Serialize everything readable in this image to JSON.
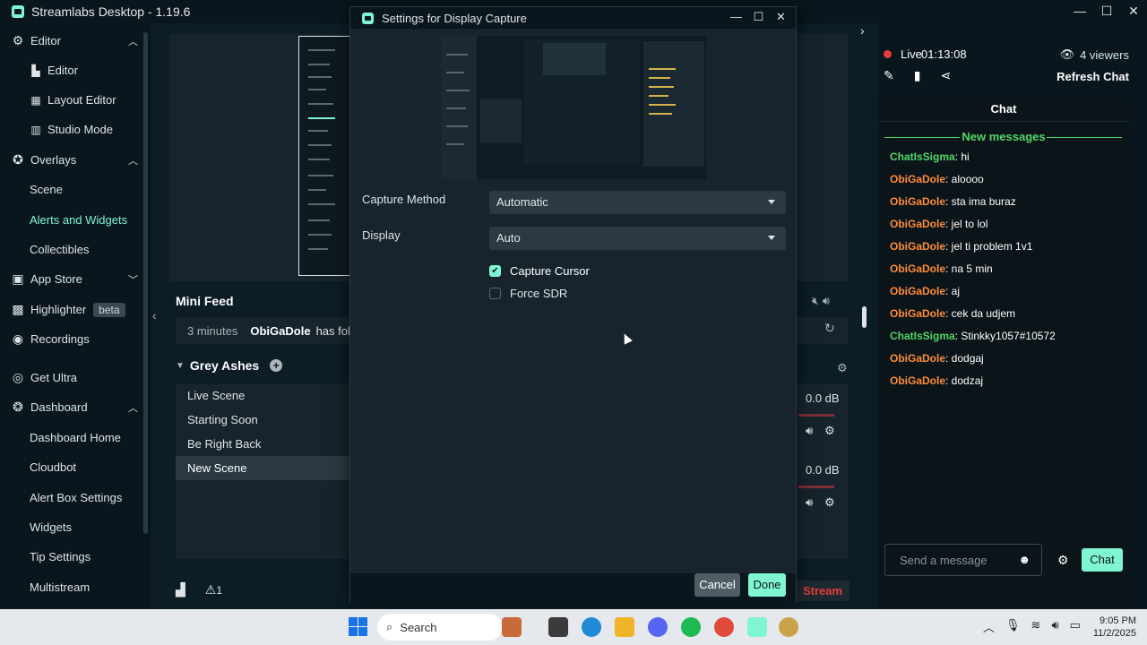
{
  "app": {
    "title": "Streamlabs Desktop - 1.19.6"
  },
  "window_controls": {
    "minimize": "—",
    "maximize": "☐",
    "close": "✕"
  },
  "sidebar": {
    "groups": [
      {
        "label": "Editor",
        "items": [
          "Editor",
          "Layout Editor",
          "Studio Mode"
        ]
      },
      {
        "label": "Overlays",
        "items": [
          "Scene",
          "Alerts and Widgets",
          "Collectibles"
        ]
      },
      {
        "label": "App Store"
      },
      {
        "label": "Highlighter",
        "badge": "beta"
      },
      {
        "label": "Recordings"
      },
      {
        "label": "Get Ultra"
      },
      {
        "label": "Dashboard",
        "items": [
          "Dashboard Home",
          "Cloudbot",
          "Alert Box Settings",
          "Widgets",
          "Tip Settings",
          "Multistream"
        ]
      }
    ],
    "active_item": "Alerts and Widgets"
  },
  "mini_feed": {
    "title": "Mini Feed",
    "time": "3 minutes",
    "user": "ObiGaDole",
    "action": "has follow"
  },
  "scenes": {
    "collection": "Grey Ashes",
    "items": [
      "Live Scene",
      "Starting Soon",
      "Be Right Back",
      "New Scene"
    ],
    "selected": "New Scene"
  },
  "mixer": {
    "levels": [
      "0.0 dB",
      "0.0 dB"
    ]
  },
  "bottom": {
    "alerts_count": "1",
    "go_live": "Stream"
  },
  "dialog": {
    "title": "Settings for Display Capture",
    "capture_method_label": "Capture Method",
    "capture_method_value": "Automatic",
    "display_label": "Display",
    "display_value": "Auto",
    "capture_cursor_label": "Capture Cursor",
    "capture_cursor_checked": true,
    "force_sdr_label": "Force SDR",
    "force_sdr_checked": false,
    "cancel_label": "Cancel",
    "done_label": "Done"
  },
  "stream": {
    "live_label": "Live",
    "uptime": "01:13:08",
    "viewers": "4 viewers",
    "refresh_chat": "Refresh Chat"
  },
  "chat": {
    "header": "Chat",
    "new_messages": "New messages",
    "messages": [
      {
        "user": "ChatIsSigma",
        "text": ": hi",
        "color": "#53d769"
      },
      {
        "user": "ObiGaDole",
        "text": ": aloooo",
        "color": "#ff8c3a"
      },
      {
        "user": "ObiGaDole",
        "text": ": sta ima buraz",
        "color": "#ff8c3a"
      },
      {
        "user": "ObiGaDole",
        "text": ": jel to lol",
        "color": "#ff8c3a"
      },
      {
        "user": "ObiGaDole",
        "text": ": jel ti problem 1v1",
        "color": "#ff8c3a"
      },
      {
        "user": "ObiGaDole",
        "text": ": na 5 min",
        "color": "#ff8c3a"
      },
      {
        "user": "ObiGaDole",
        "text": ": aj",
        "color": "#ff8c3a"
      },
      {
        "user": "ObiGaDole",
        "text": ": cek da udjem",
        "color": "#ff8c3a"
      },
      {
        "user": "ChatIsSigma",
        "text": ": Stinkky1057#10572",
        "color": "#53d769"
      },
      {
        "user": "ObiGaDole",
        "text": ": dodgaj",
        "color": "#ff8c3a"
      },
      {
        "user": "ObiGaDole",
        "text": ": dodzaj",
        "color": "#ff8c3a"
      }
    ],
    "input_placeholder": "Send a message",
    "send_label": "Chat"
  },
  "taskbar": {
    "search_label": "Search",
    "time": "9:05 PM",
    "date": "11/2/2025"
  },
  "colors": {
    "accent": "#80f5d2",
    "live": "#e53e3e",
    "new_messages": "#53d769"
  }
}
